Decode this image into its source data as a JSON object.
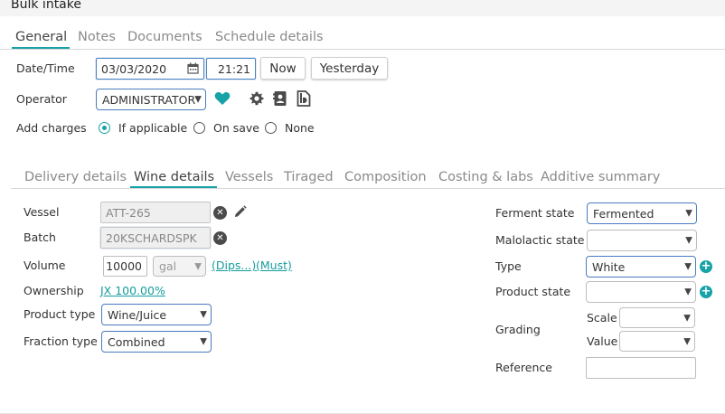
{
  "window": {
    "title": "Bulk intake"
  },
  "top_tabs": [
    "General",
    "Notes",
    "Documents",
    "Schedule details"
  ],
  "general": {
    "datetime_label": "Date/Time",
    "date": "03/03/2020",
    "time": "21:21",
    "now_button": "Now",
    "yesterday_button": "Yesterday",
    "operator_label": "Operator",
    "operator_value": "ADMINISTRATOR",
    "add_charges_label": "Add charges",
    "charges_options": [
      "If applicable",
      "On save",
      "None"
    ],
    "charges_selected": "If applicable"
  },
  "sub_tabs": [
    "Delivery details",
    "Wine details",
    "Vessels",
    "Tiraged",
    "Composition",
    "Costing & labs",
    "Additive summary"
  ],
  "wine_details": {
    "vessel_label": "Vessel",
    "vessel_value": "ATT-265",
    "batch_label": "Batch",
    "batch_value": "20KSCHARDSPK",
    "volume_label": "Volume",
    "volume_value": "10000",
    "volume_unit": "gal",
    "dips_link": "(Dips...)",
    "must_link": "(Must)",
    "ownership_label": "Ownership",
    "ownership_link": "JX 100.00%",
    "product_type_label": "Product type",
    "product_type_value": "Wine/Juice",
    "fraction_type_label": "Fraction type",
    "fraction_type_value": "Combined",
    "ferment_state_label": "Ferment state",
    "ferment_state_value": "Fermented",
    "malolactic_state_label": "Malolactic state",
    "malolactic_state_value": "",
    "type_label": "Type",
    "type_value": "White",
    "product_state_label": "Product state",
    "product_state_value": "",
    "grading_label": "Grading",
    "scale_label": "Scale",
    "scale_value": "",
    "value_label": "Value",
    "value_value": "",
    "reference_label": "Reference",
    "reference_value": ""
  },
  "colors": {
    "accent": "#17a2a7",
    "focus_border": "#4a7bbf",
    "heart": "#17a2a7"
  },
  "icons": [
    "calendar-icon",
    "caret-down-icon",
    "heart-icon",
    "gear-icon",
    "contact-card-icon",
    "document-icon",
    "clear-icon",
    "pencil-icon",
    "add-icon"
  ]
}
